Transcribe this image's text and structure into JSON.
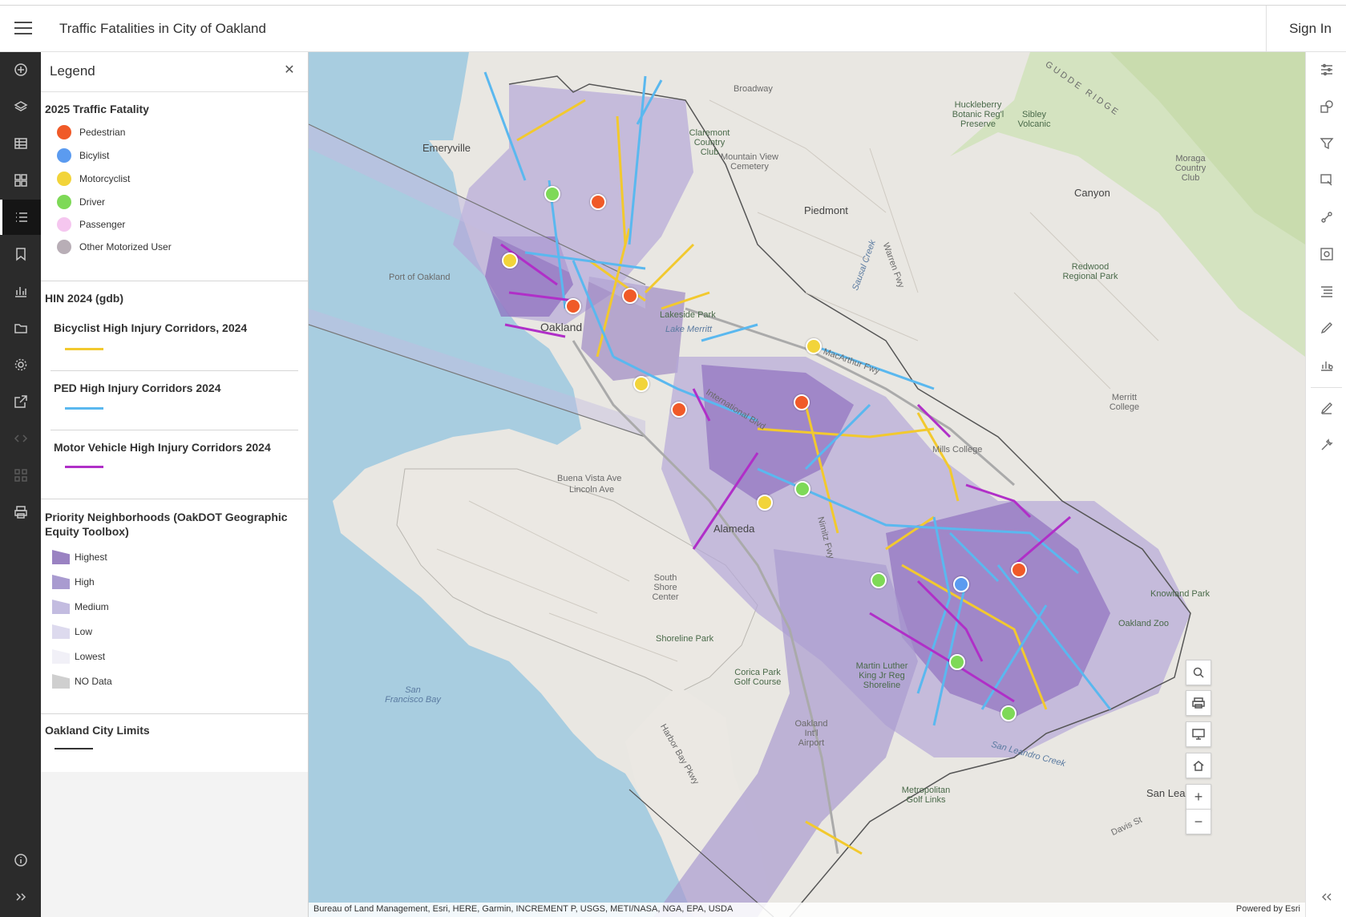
{
  "header": {
    "title": "Traffic Fatalities in City of Oakland",
    "sign_in": "Sign In"
  },
  "left_actions": [
    "add-icon",
    "layers-icon",
    "table-icon",
    "basemap-icon",
    "legend-icon",
    "bookmark-icon",
    "chart-icon",
    "folder-icon",
    "settings-icon",
    "share-icon",
    "embed-icon",
    "apps-icon",
    "print-icon",
    "info-icon",
    "expand-icon"
  ],
  "legend": {
    "title": "Legend",
    "fatality": {
      "title": "2025 Traffic Fatality",
      "items": [
        {
          "label": "Pedestrian",
          "color": "#f05a28"
        },
        {
          "label": "Bicylist",
          "color": "#5b9bf0"
        },
        {
          "label": "Motorcyclist",
          "color": "#f2d43a"
        },
        {
          "label": "Driver",
          "color": "#7ed957"
        },
        {
          "label": "Passenger",
          "color": "#f5c6ef"
        },
        {
          "label": "Other Motorized User",
          "color": "#b8aeb6"
        }
      ]
    },
    "hin": {
      "title": "HIN 2024 (gdb)",
      "layers": [
        {
          "label": "Bicyclist High Injury Corridors, 2024",
          "color": "#f2c92e"
        },
        {
          "label": "PED High Injury Corridors 2024",
          "color": "#5ab8ef"
        },
        {
          "label": "Motor Vehicle High Injury Corridors 2024",
          "color": "#b02fc8"
        }
      ]
    },
    "priority": {
      "title": "Priority Neighborhoods (OakDOT Geographic Equity Toolbox)",
      "items": [
        {
          "label": "Highest",
          "color": "#9a82c2"
        },
        {
          "label": "High",
          "color": "#a99bd0"
        },
        {
          "label": "Medium",
          "color": "#c3bce0"
        },
        {
          "label": "Low",
          "color": "#dddaee"
        },
        {
          "label": "Lowest",
          "color": "#f1f0f7"
        },
        {
          "label": "NO Data",
          "color": "#cfcfcf"
        }
      ]
    },
    "city_limits": {
      "title": "Oakland City Limits",
      "color": "#333333"
    }
  },
  "map": {
    "attribution": "Bureau of Land Management, Esri, HERE, Garmin, INCREMENT P, USGS, METI/NASA, NGA, EPA, USDA",
    "powered_by": "Powered by Esri",
    "labels": {
      "emeryville": "Emeryville",
      "oakland": "Oakland",
      "piedmont": "Piedmont",
      "alameda": "Alameda",
      "san_leandro": "San Leandro",
      "canyon": "Canyon",
      "sf_bay": "San Francisco Bay",
      "broadway": "Broadway",
      "lakeside": "Lakeside Park",
      "lake_merritt": "Lake Merritt",
      "macarthur": "MacArthur Fwy",
      "international": "International Blvd",
      "buena_vista": "Buena Vista Ave",
      "lincoln": "Lincoln Ave",
      "shoreline_park": "Shoreline Park",
      "oakland_airport": "Oakland Int'l Airport",
      "redwood_park": "Redwood Regional Park",
      "mills_college": "Mills College",
      "merritt_college": "Merritt College",
      "oakland_zoo": "Oakland Zoo",
      "knowland_park": "Knowland Park",
      "corica": "Corica Park Golf Course",
      "harbor_bay": "Harbor Bay Pkwy",
      "nimitz": "Nimitz Fwy",
      "davis_st": "Davis St",
      "port": "Port of Oakland",
      "huckleberry": "Huckleberry Botanic Reg'l Preserve",
      "sibley": "Sibley Volcanic",
      "moraga": "Moraga Country Club",
      "south_shore": "South Shore Center",
      "mlk_shoreline": "Martin Luther King Jr Reg Shoreline",
      "metro_golf": "Metropolitan Golf Links",
      "san_leandro_creek": "San Leandro Creek",
      "mountain_view": "Mountain View Cemetery",
      "claremont": "Claremont Country Club",
      "gudde_ridge": "GUDDE RIDGE",
      "sausal": "Sausal Creek",
      "warren": "Warren Fwy"
    },
    "fatalities": [
      {
        "type": "Driver",
        "color": "#7ed957"
      },
      {
        "type": "Pedestrian",
        "color": "#f05a28"
      },
      {
        "type": "Motorcyclist",
        "color": "#f2d43a"
      },
      {
        "type": "Pedestrian",
        "color": "#f05a28"
      },
      {
        "type": "Pedestrian",
        "color": "#f05a28"
      },
      {
        "type": "Motorcyclist",
        "color": "#f2d43a"
      },
      {
        "type": "Pedestrian",
        "color": "#f05a28"
      },
      {
        "type": "Motorcyclist",
        "color": "#f2d43a"
      },
      {
        "type": "Pedestrian",
        "color": "#f05a28"
      },
      {
        "type": "Driver",
        "color": "#7ed957"
      },
      {
        "type": "Motorcyclist",
        "color": "#f2d43a"
      },
      {
        "type": "Driver",
        "color": "#7ed957"
      },
      {
        "type": "Bicylist",
        "color": "#5b9bf0"
      },
      {
        "type": "Pedestrian",
        "color": "#f05a28"
      },
      {
        "type": "Driver",
        "color": "#7ed957"
      },
      {
        "type": "Driver",
        "color": "#7ed957"
      }
    ],
    "zoom_in": "+",
    "zoom_out": "−"
  },
  "right_actions": [
    "filter-settings-icon",
    "shapes-icon",
    "filter-icon",
    "select-icon",
    "measure-icon",
    "screen-icon",
    "list-icon",
    "sketch-icon",
    "analysis-icon",
    "edit-icon",
    "wrench-icon",
    "collapse-icon"
  ]
}
